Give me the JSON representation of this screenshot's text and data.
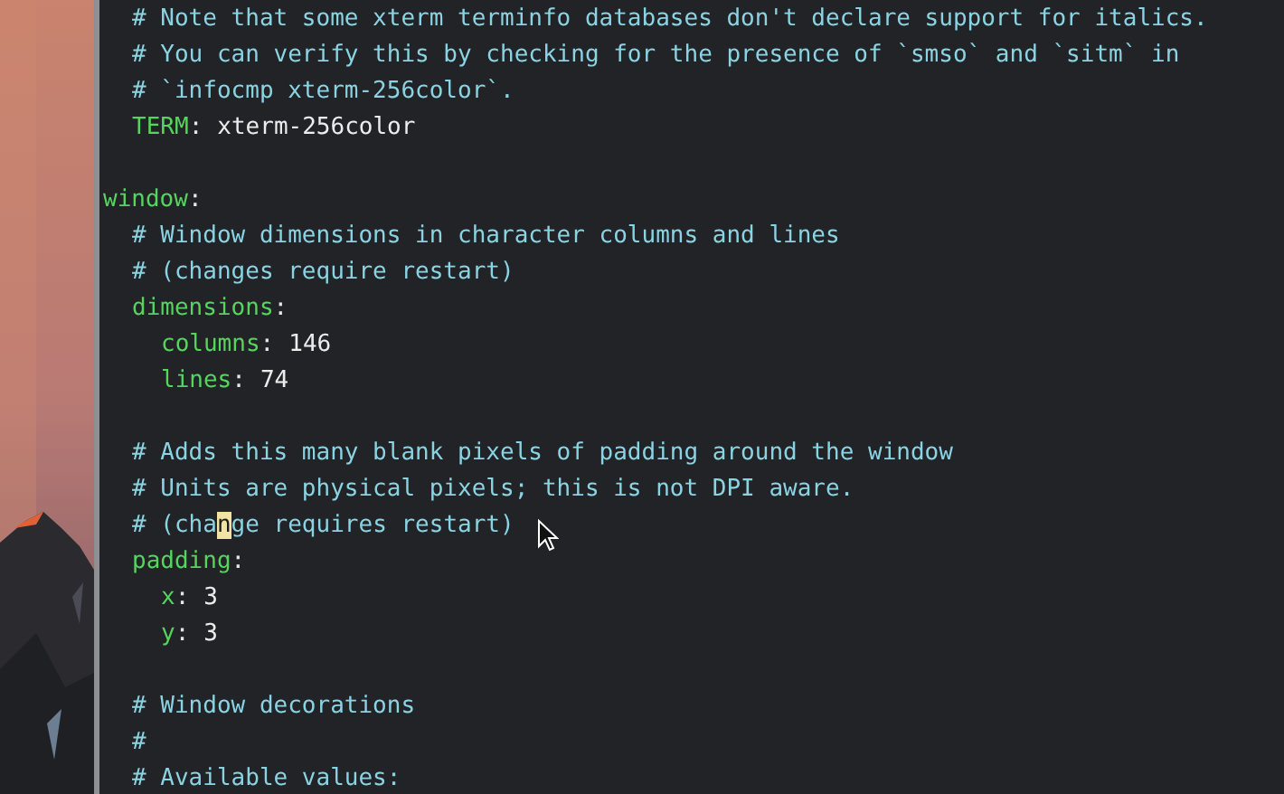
{
  "editor": {
    "lines": [
      {
        "kind": "group",
        "children": [
          {
            "kind": "comment",
            "text": "# Note that some xterm terminfo databases don't declare support for italics."
          },
          {
            "kind": "comment",
            "text": "# You can verify this by checking for the presence of `smso` and `sitm` in"
          },
          {
            "kind": "comment",
            "text": "# `infocmp xterm-256color`."
          },
          {
            "kind": "pair",
            "key": "TERM",
            "sep": ":",
            "value": "xterm-256color"
          },
          {
            "kind": "blank"
          }
        ]
      },
      {
        "kind": "pair",
        "key": "window",
        "sep": ":",
        "children": [
          {
            "kind": "comment",
            "text": "# Window dimensions in character columns and lines"
          },
          {
            "kind": "comment",
            "text": "# (changes require restart)"
          },
          {
            "kind": "pair",
            "key": "dimensions",
            "sep": ":",
            "children": [
              {
                "kind": "pair",
                "key": "columns",
                "sep": ":",
                "value": "146"
              },
              {
                "kind": "pair",
                "key": "lines",
                "sep": ":",
                "value": "74"
              }
            ]
          },
          {
            "kind": "blank"
          },
          {
            "kind": "comment",
            "text": "# Adds this many blank pixels of padding around the window"
          },
          {
            "kind": "comment",
            "text": "# Units are physical pixels; this is not DPI aware."
          },
          {
            "kind": "comment",
            "text": "# (cha",
            "cursor": "n",
            "after": "ge requires restart)"
          },
          {
            "kind": "pair",
            "key": "padding",
            "sep": ":",
            "children": [
              {
                "kind": "pair",
                "key": "x",
                "sep": ":",
                "value": "3"
              },
              {
                "kind": "pair",
                "key": "y",
                "sep": ":",
                "value": "3"
              }
            ]
          },
          {
            "kind": "blank"
          },
          {
            "kind": "comment",
            "text": "# Window decorations"
          },
          {
            "kind": "comment",
            "text": "#"
          },
          {
            "kind": "comment",
            "text": "# Available values:"
          }
        ]
      }
    ]
  }
}
